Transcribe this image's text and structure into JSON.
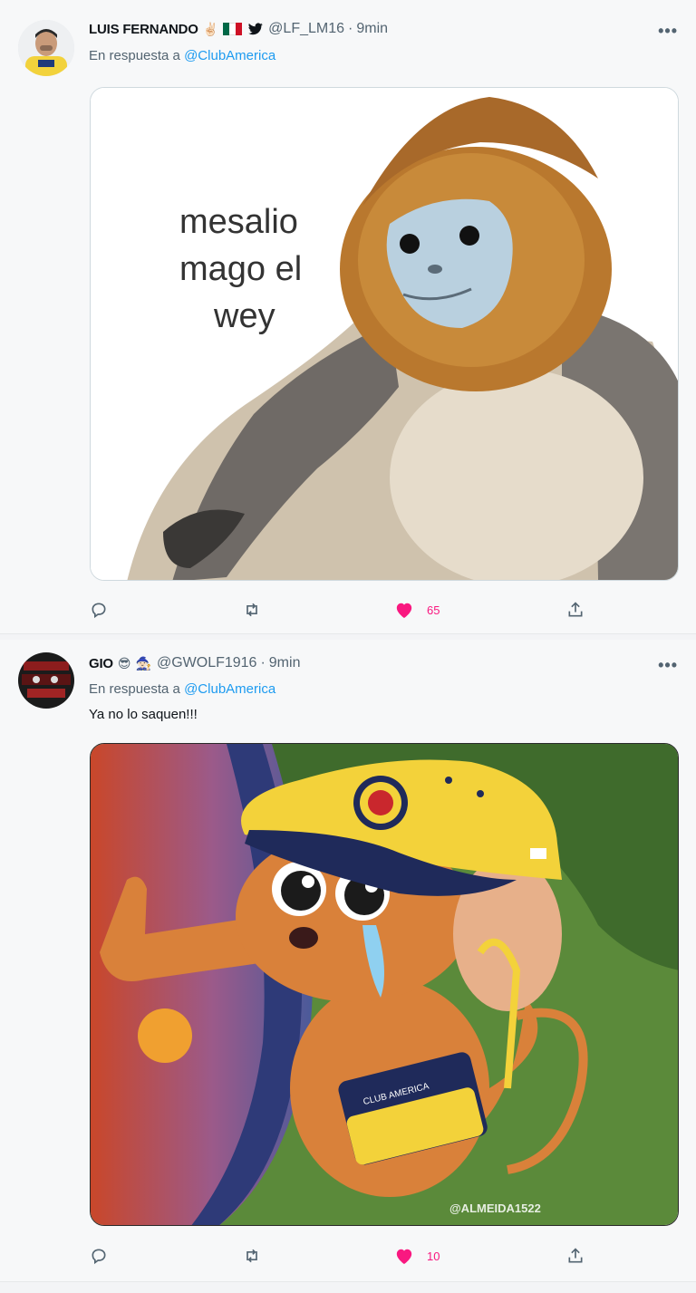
{
  "tweets": [
    {
      "display_name": "LUIS FERNANDO",
      "emojis": [
        "✌🏻",
        "🇲🇽"
      ],
      "handle": "@LF_LM16",
      "time": "9min",
      "reply_prefix": "En respuesta a",
      "reply_to": "@ClubAmerica",
      "text": "",
      "media_text": [
        "mesalio",
        "mago el",
        "wey"
      ],
      "likes": "65",
      "liked": true
    },
    {
      "display_name": "GIO",
      "emojis": [
        "😎",
        "🧙🏻"
      ],
      "handle": "@GWOLF1916",
      "time": "9min",
      "reply_prefix": "En respuesta a",
      "reply_to": "@ClubAmerica",
      "text": "Ya no lo saquen!!!",
      "media_watermark": "@ALMEIDA1522",
      "media_badge_text": "CLUB AMERICA",
      "likes": "10",
      "liked": true
    }
  ],
  "colors": {
    "accent": "#1d9bf0",
    "like": "#f91880",
    "muted": "#536471"
  }
}
